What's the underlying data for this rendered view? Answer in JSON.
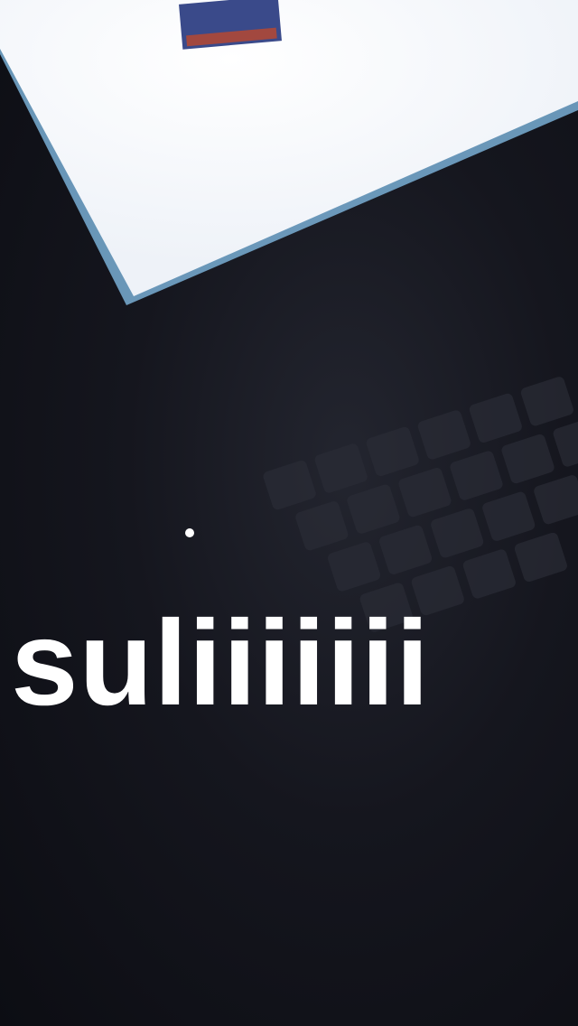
{
  "caption": {
    "text": "suliiiiiii"
  },
  "colors": {
    "screen": "#f7f8fb",
    "screen_edge": "#8fc4ea",
    "background": "#12131a",
    "caption": "#ffffff"
  }
}
